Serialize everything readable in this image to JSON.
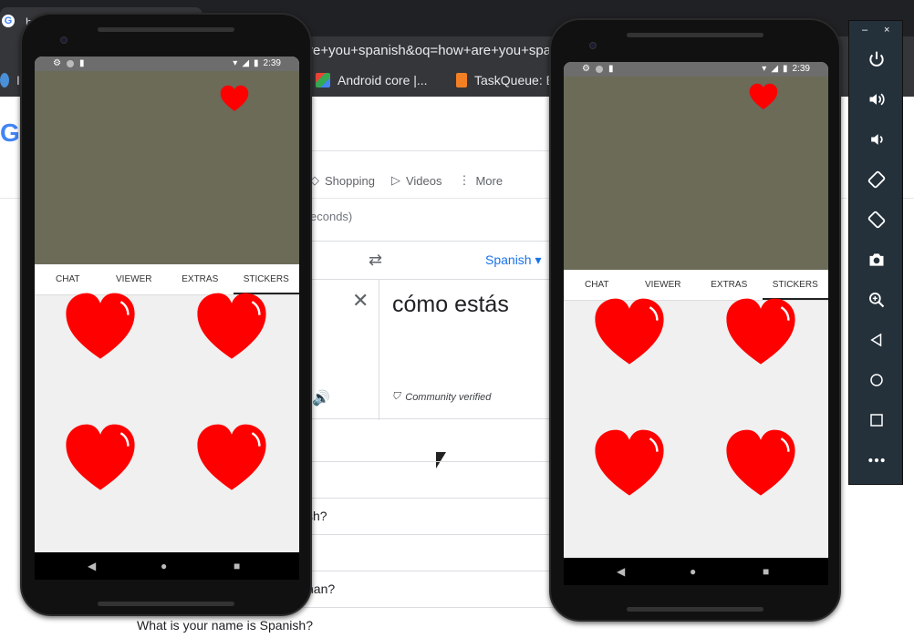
{
  "browser": {
    "tab_title": "ho",
    "omnibox_text": "re+you+spanish&oq=how+are+you+spa",
    "bookmarks": [
      {
        "label": "Ic",
        "icon": "generic-icon"
      },
      {
        "label": "Android core  |...",
        "icon": "android-core-icon"
      },
      {
        "label": "TaskQueue: E",
        "icon": "stackoverflow-icon"
      }
    ],
    "logo_fragment": "G",
    "search_tabs": [
      "Shopping",
      "Videos",
      "More"
    ],
    "results_count": "econds)",
    "translate": {
      "target_language": "Spanish",
      "result_text": "cómo estás",
      "verified_label": "Community verified"
    },
    "people_also_ask": [
      "sh?",
      "",
      "han?",
      "What is your name is Spanish?"
    ]
  },
  "phones": [
    {
      "status_time": "2:39",
      "tabs": [
        "CHAT",
        "VIEWER",
        "EXTRAS",
        "STICKERS"
      ],
      "active_tab": "STICKERS"
    },
    {
      "status_time": "2:39",
      "tabs": [
        "CHAT",
        "VIEWER",
        "EXTRAS",
        "STICKERS"
      ],
      "active_tab": "STICKERS"
    }
  ],
  "emulator_toolbar": {
    "window_buttons": [
      "–",
      "×"
    ],
    "tools": [
      "power-icon",
      "volume-up-icon",
      "volume-down-icon",
      "rotate-left-icon",
      "rotate-right-icon",
      "camera-icon",
      "zoom-icon",
      "back-icon",
      "home-icon",
      "overview-icon",
      "more-icon"
    ]
  },
  "colors": {
    "video_bg": "#6b6b58",
    "heart_red": "#ff0000",
    "sticker_bg": "#f0f0f0",
    "toolbar_bg": "#24303a"
  }
}
